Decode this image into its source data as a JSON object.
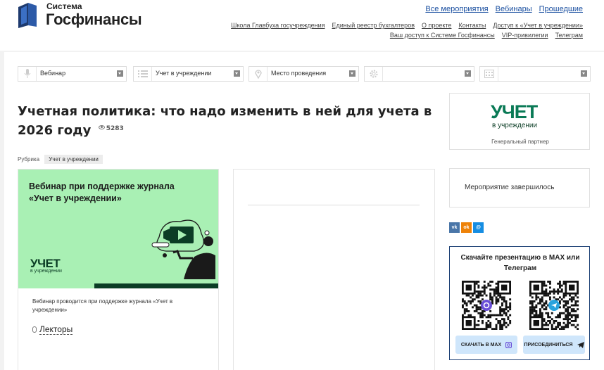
{
  "logo": {
    "small": "Система",
    "big": "Госфинансы"
  },
  "nav": {
    "main": [
      "Все мероприятия",
      "Вебинары",
      "Прошедшие"
    ],
    "sub_row1": [
      "Школа Главбуха госучреждения",
      "Единый реестр бухгалтеров",
      "О проекте",
      "Контакты",
      "Доступ к «Учет в учреждении»"
    ],
    "sub_row2": [
      "Ваш доступ к Системе Госфинансы",
      "VIP-привилегии",
      "Телеграм"
    ]
  },
  "filters": [
    {
      "icon": "mic-icon",
      "label": "Вебинар"
    },
    {
      "icon": "list-icon",
      "label": "Учет в учреждении"
    },
    {
      "icon": "location-icon",
      "label": "Место проведения"
    },
    {
      "icon": "gear-icon",
      "label": ""
    },
    {
      "icon": "calendar-icon",
      "label": ""
    }
  ],
  "event": {
    "title": "Учетная политика: что надо изменить в ней для учета в 2026 году",
    "views": "5283",
    "rubric_label": "Рубрика",
    "rubric": "Учет в учреждении"
  },
  "banner": {
    "text": "Вебинар при поддержке журнала «Учет в учреждении»",
    "logo_big": "УЧЕТ",
    "logo_small": "в учреждении"
  },
  "card": {
    "description": "Вебинар проводится при поддержке журнала «Учет в учреждении»",
    "lectors": "Лекторы"
  },
  "partner": {
    "logo_big": "УЧЕТ",
    "logo_small": "в учреждении",
    "caption": "Генеральный партнер"
  },
  "status": "Мероприятие завершилось",
  "social": [
    {
      "name": "vk",
      "label": "vk",
      "color": "#4a76a8"
    },
    {
      "name": "ok",
      "label": "ok",
      "color": "#ee8208"
    },
    {
      "name": "mm",
      "label": "@",
      "color": "#168de2"
    }
  ],
  "qr": {
    "title": "Скачайте презентацию в MAX или Телеграм",
    "btn_max": "СКАЧАТЬ В MAX",
    "btn_tg": "ПРИСОЕДИНИТЬСЯ"
  },
  "colors": {
    "link": "#1a4fa0",
    "banner_bg": "#a9f0b4",
    "partner_green": "#0a7a56",
    "qr_border": "#1a3e73",
    "qr_button": "#cfe6fb"
  }
}
